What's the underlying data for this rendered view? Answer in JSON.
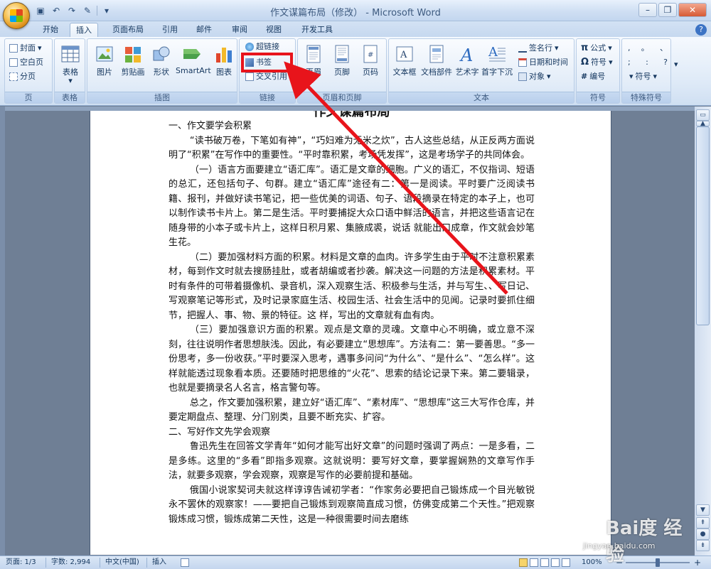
{
  "window": {
    "title": "作文谋篇布局（修改） - Microsoft Word",
    "controls": {
      "minimize": "–",
      "restore": "❐",
      "close": "✕"
    }
  },
  "quick_access": {
    "save_icon": "save-icon",
    "undo_icon": "undo-icon",
    "redo_icon": "redo-icon",
    "format_icon": "format-painter-icon"
  },
  "tabs": [
    "开始",
    "插入",
    "页面布局",
    "引用",
    "邮件",
    "审阅",
    "视图",
    "开发工具"
  ],
  "active_tab": "插入",
  "help": "?",
  "ribbon": {
    "groups": {
      "page": {
        "label": "页",
        "items": [
          "封面",
          "空白页",
          "分页"
        ]
      },
      "table": {
        "label": "表格",
        "button": "表格"
      },
      "illustrations": {
        "label": "插图",
        "buttons": [
          "图片",
          "剪贴画",
          "形状",
          "SmartArt",
          "图表"
        ]
      },
      "links": {
        "label": "链接",
        "items": [
          "超链接",
          "书签",
          "交叉引用"
        ]
      },
      "header_footer": {
        "label": "页眉和页脚",
        "buttons": [
          "页眉",
          "页脚",
          "页码"
        ]
      },
      "text": {
        "label": "文本",
        "buttons": [
          "文本框",
          "文档部件",
          "艺术字",
          "首字下沉"
        ],
        "items": [
          "签名行",
          "日期和时间",
          "对象"
        ]
      },
      "symbols": {
        "label": "符号",
        "items": [
          "公式",
          "符号",
          "编号"
        ]
      },
      "special": {
        "label": "特殊符号",
        "glyphs": [
          ", ",
          "。",
          "、",
          ";",
          ":",
          "?"
        ],
        "more": "符号"
      }
    }
  },
  "document": {
    "heading": "作文谋篇布局",
    "paragraphs": [
      {
        "text": "一、作文要学会积累",
        "indent": false
      },
      {
        "text": "“读书破万卷，下笔如有神”，“巧妇难为无米之炊”，古人这些总结，从正反两方面说明了“积累”在写作中的重要性。“平时靠积累，考场凭发挥”，这是考场学子的共同体会。",
        "indent": true
      },
      {
        "text": "（一）语言方面要建立“语汇库”。语汇是文章的细胞。广义的语汇，不仅指词、短语的总汇，还包括句子、句群。建立“语汇库”途径有二：第一是阅读。平时要广泛阅读书籍、报刊，并做好读书笔记，把一些优美的词语、句子、语段摘录在特定的本子上，也可以制作读书卡片上。第二是生活。平时要捕捉大众口语中鲜活的语言，并把这些语言记在随身带的小本子或卡片上，这样日积月累、集腋成裘，说话 就能出口成章，作文就会妙笔生花。",
        "indent": true
      },
      {
        "text": "（二）要加强材料方面的积累。材料是文章的血肉。许多学生由于平时不注意积累素材，每到作文时就去搜肠挂肚，或者胡编或者抄袭。解决这一问题的方法是积累素材。平时有条件的可带着摄像机、录音机，深入观察生活、积极参与生活，并与写生、、写日记、写观察笔记等形式，及时记录家庭生活、校园生活、社会生活中的见闻。记录时要抓住细节，把握人、事、物、景的特征。这 样，写出的文章就有血有肉。",
        "indent": true
      },
      {
        "text": "（三）要加强意识方面的积累。观点是文章的灵魂。文章中心不明确，或立意不深刻，往往说明作者思想肤浅。因此，有必要建立“思想库”。方法有二：第一要善思。“多一份思考，多一份收获。”平时要深入思考，遇事多问问“为什么”、“是什么”、“怎么样”。这样就能透过现象看本质。还要随时把思维的“火花”、思索的结论记录下来。第二要辑录，也就是要摘录名人名言，格言警句等。",
        "indent": true
      },
      {
        "text": "总之，作文要加强积累，建立好“语汇库”、“素材库”、“思想库”这三大写作仓库，并要定期盘点、整理、分门别类，且要不断充实、扩容。",
        "indent": true
      },
      {
        "text": "二、写好作文先学会观察",
        "indent": false
      },
      {
        "text": "鲁迅先生在回答文学青年“如何才能写出好文章”的问题时强调了两点：一是多看，二是多练。这里的“多看”即指多观察。这就说明：要写好文章，要掌握娴熟的文章写作手法，就要多观察，学会观察，观察是写作的必要前提和基础。",
        "indent": true
      },
      {
        "text": "俄国小说家契诃夫就这样谆谆告诫初学者：“作家务必要把自己锻炼成一个目光敏锐永不罢休的观察家！——要把自己锻炼到观察简直成习惯，仿佛变成第二个天性。”把观察锻炼成习惯，锻炼成第二天性，这是一种很需要时间去磨练",
        "indent": true
      }
    ]
  },
  "status_bar": {
    "page": "页面: 1/3",
    "words": "字数: 2,994",
    "language": "中文(中国)",
    "mode": "插入",
    "zoom": "100%",
    "zoom_minus": "−",
    "zoom_plus": "+"
  },
  "watermark": {
    "text": "Bai度 经验",
    "url": "jingyan.baidu.com"
  },
  "annotation": {
    "highlight_color": "#e8141b"
  }
}
